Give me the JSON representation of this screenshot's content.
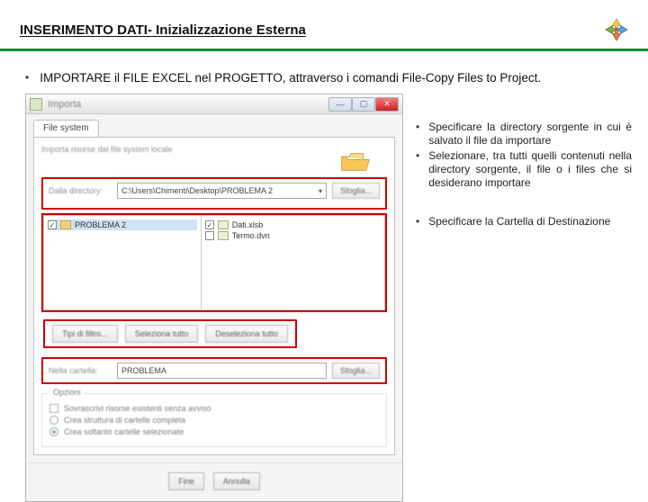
{
  "title": {
    "prefix": "INSERIMENTO DATI",
    "suffix": "- Inizializzazione Esterna"
  },
  "main_bullet": "IMPORTARE il FILE EXCEL nel PROGETTO, attraverso i comandi File-Copy Files to Project.",
  "dialog": {
    "window_title": "Importa",
    "tab_label": "File system",
    "description": "Importa risorse dal file system locale",
    "from_dir_label": "Dalla directory:",
    "from_dir_value": "C:\\Users\\Chimenti\\Desktop\\PROBLEMA 2",
    "browse_label": "Sfoglia...",
    "left_tree_item": "PROBLEMA 2",
    "right_items": [
      {
        "label": "Dati.xlsb",
        "checked": true
      },
      {
        "label": "Termo.dvn",
        "checked": false
      }
    ],
    "mid_buttons": {
      "filter_types": "Tipi di filtro...",
      "select_all": "Seleziona tutto",
      "deselect_all": "Deseleziona tutto"
    },
    "into_folder_label": "Nella cartella:",
    "into_folder_value": "PROBLEMA",
    "options": {
      "legend": "Opzioni",
      "r1": "Sovrascrivi risorse esistenti senza avviso",
      "r2": "Crea struttura di cartelle completa",
      "r3": "Crea soltanto cartelle selezionate"
    },
    "footer": {
      "finish": "Fine",
      "cancel": "Annulla"
    },
    "winbtns": {
      "min": "—",
      "max": "▢",
      "close": "✕"
    }
  },
  "notes": {
    "n1": "Specificare la directory sorgente in cui è salvato il file da importare",
    "n2": "Selezionare, tra tutti quelli contenuti nella directory sorgente, il file o i files che si desiderano importare",
    "n3": "Specificare la Cartella di Destinazione"
  }
}
